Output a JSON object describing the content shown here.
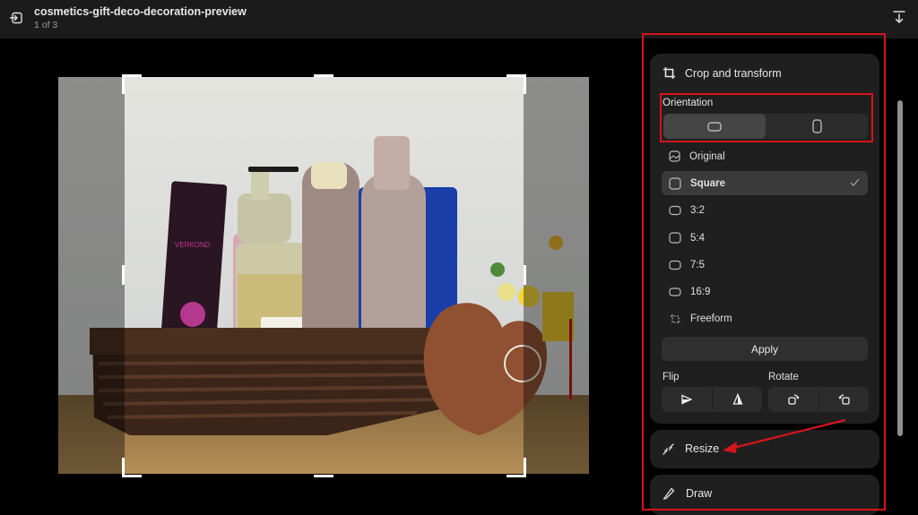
{
  "header": {
    "title": "cosmetics-gift-deco-decoration-preview",
    "counter": "1 of 3",
    "back_icon": "exit-icon",
    "save_icon": "download-icon"
  },
  "image": {
    "description": "Woven basket with cosmetics bottles, heart-shaped sponge and flowers on a wooden table",
    "crop_aspect": "Square"
  },
  "panel": {
    "crop": {
      "title": "Crop and transform",
      "icon": "crop-icon",
      "orientation_label": "Orientation",
      "orientation_options": [
        {
          "name": "landscape",
          "icon": "landscape-icon",
          "active": true
        },
        {
          "name": "portrait",
          "icon": "portrait-icon",
          "active": false
        }
      ],
      "ratios": [
        {
          "label": "Original",
          "icon": "image-icon",
          "selected": false
        },
        {
          "label": "Square",
          "icon": "square-icon",
          "selected": true
        },
        {
          "label": "3:2",
          "icon": "ratio-icon",
          "selected": false
        },
        {
          "label": "5:4",
          "icon": "ratio-icon",
          "selected": false
        },
        {
          "label": "7:5",
          "icon": "ratio-icon",
          "selected": false
        },
        {
          "label": "16:9",
          "icon": "ratio-icon",
          "selected": false
        },
        {
          "label": "Freeform",
          "icon": "freeform-icon",
          "selected": false
        }
      ],
      "apply_label": "Apply",
      "flip_label": "Flip",
      "rotate_label": "Rotate"
    },
    "resize": {
      "label": "Resize",
      "icon": "resize-icon"
    },
    "draw": {
      "label": "Draw",
      "icon": "draw-icon"
    }
  },
  "annotations": {
    "highlight_color": "#d5141b"
  }
}
